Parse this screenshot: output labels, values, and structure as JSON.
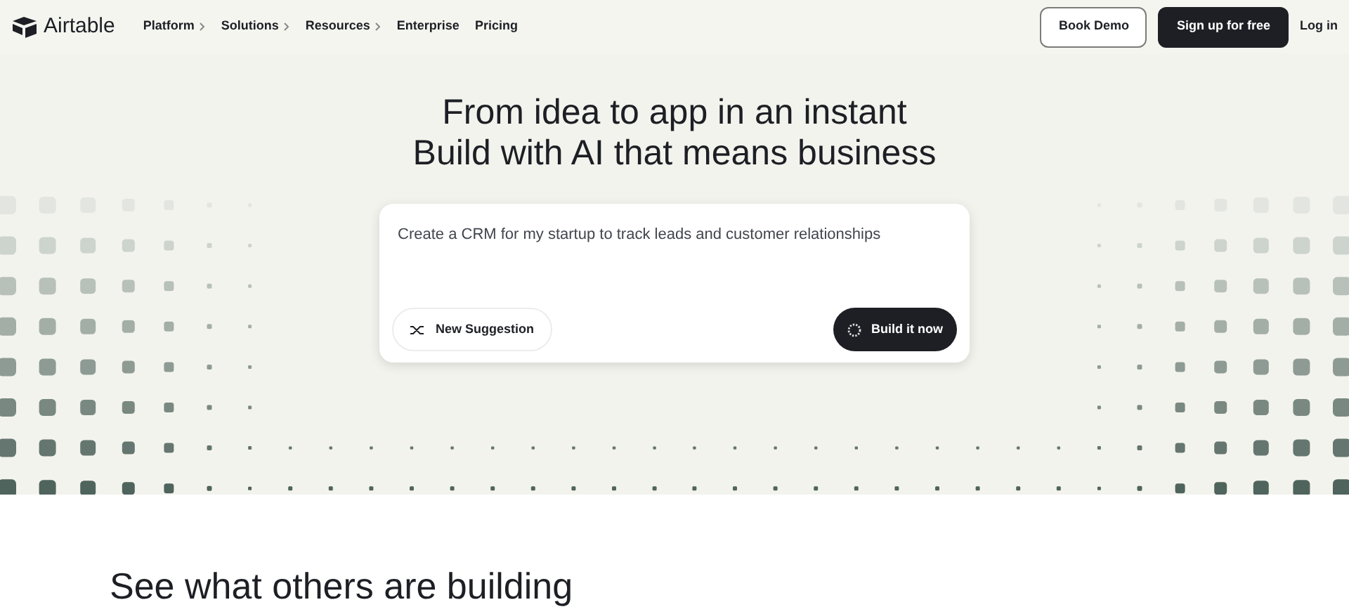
{
  "nav": {
    "brand": "Airtable",
    "items": [
      {
        "label": "Platform",
        "has_submenu": true
      },
      {
        "label": "Solutions",
        "has_submenu": true
      },
      {
        "label": "Resources",
        "has_submenu": true
      },
      {
        "label": "Enterprise",
        "has_submenu": false
      },
      {
        "label": "Pricing",
        "has_submenu": false
      }
    ],
    "book_demo": "Book Demo",
    "sign_up": "Sign up for free",
    "log_in": "Log in"
  },
  "hero": {
    "title_lines": [
      "From idea to app in an instant",
      "Build with AI that means business"
    ],
    "prompt": {
      "value": "Create a CRM for my startup to track leads and customer relationships"
    },
    "suggestion_button": "New Suggestion",
    "build_button": "Build it now"
  },
  "section_title": "See what others are building"
}
